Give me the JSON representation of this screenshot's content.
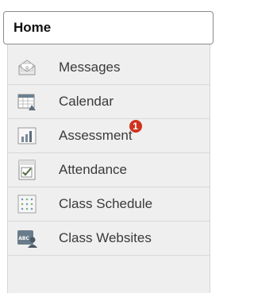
{
  "home": {
    "label": "Home"
  },
  "menu": {
    "items": [
      {
        "label": "Messages",
        "icon": "envelope-icon"
      },
      {
        "label": "Calendar",
        "icon": "calendar-icon"
      },
      {
        "label": "Assessment",
        "icon": "bar-chart-icon",
        "badge": "1"
      },
      {
        "label": "Attendance",
        "icon": "checkbox-icon"
      },
      {
        "label": "Class Schedule",
        "icon": "schedule-grid-icon"
      },
      {
        "label": "Class Websites",
        "icon": "website-user-icon"
      }
    ]
  },
  "colors": {
    "menu_bg": "#efefef",
    "badge": "#d0341f",
    "text": "#3a3a3a"
  }
}
